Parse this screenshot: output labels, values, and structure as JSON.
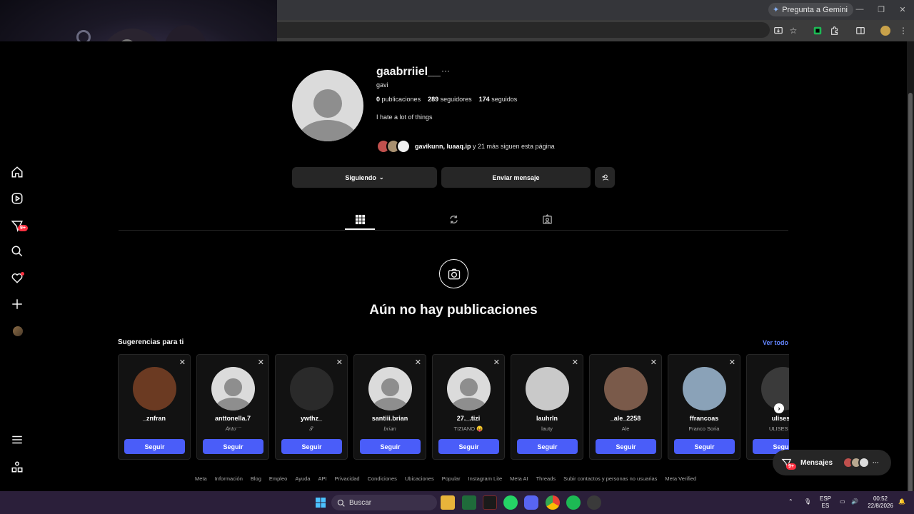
{
  "browser": {
    "gemini_label": "Pregunta a Gemini",
    "gemini_icon": "sparkle-icon"
  },
  "profile": {
    "username": "gaabrriiel__",
    "more": "···",
    "full_name": "gavi",
    "posts_count": "0",
    "posts_label": "publicaciones",
    "followers_count": "289",
    "followers_label": "seguidores",
    "following_count": "174",
    "following_label": "seguidos",
    "bio": "I hate a lot of things",
    "followed_by_names": "gavikunn, luaaq.ip",
    "followed_by_rest": " y 21 más siguen esta página",
    "following_button": "Siguiendo",
    "message_button": "Enviar mensaje"
  },
  "empty_state": {
    "title": "Aún no hay publicaciones"
  },
  "suggestions": {
    "title": "Sugerencias para ti",
    "see_all": "Ver todo",
    "follow_label": "Seguir",
    "close_label": "✕",
    "items": [
      {
        "username": "_znfran",
        "subtitle": "",
        "avatar_color": "#6b3a22"
      },
      {
        "username": "anttonella.7",
        "subtitle": "𝐴𝑛𝑡𝑜 ̈ ͘ ̈",
        "avatar_color": "default"
      },
      {
        "username": "ywthz_",
        "subtitle": "𝒯",
        "avatar_color": "#2a2a2a"
      },
      {
        "username": "santiii.brian",
        "subtitle": "𝑏𝑟𝑖𝑎𝑛",
        "avatar_color": "default"
      },
      {
        "username": "27._.tizi",
        "subtitle": "TIZIANO 😝",
        "avatar_color": "default"
      },
      {
        "username": "lauhrln",
        "subtitle": "lauty",
        "avatar_color": "#c9c9c9"
      },
      {
        "username": "_ale_2258",
        "subtitle": "Ale",
        "avatar_color": "#7a5a4a"
      },
      {
        "username": "ffrancoas",
        "subtitle": "Franco Soria",
        "avatar_color": "#8aa2b8"
      },
      {
        "username": "ulisesc",
        "subtitle": "ULISES 🤍",
        "avatar_color": "#3a3a3a"
      }
    ]
  },
  "footer": [
    "Meta",
    "Información",
    "Blog",
    "Empleo",
    "Ayuda",
    "API",
    "Privacidad",
    "Condiciones",
    "Ubicaciones",
    "Popular",
    "Instagram Lite",
    "Meta AI",
    "Threads",
    "Subir contactos y personas no usuarias",
    "Meta Verified"
  ],
  "messages": {
    "label": "Mensajes",
    "badge": "9+"
  },
  "sidebar": {
    "notif_badge": "9+"
  },
  "taskbar": {
    "search_placeholder": "Buscar",
    "lang_top": "ESP",
    "lang_bottom": "ES",
    "time": "00:52",
    "date": "22/8/2026"
  }
}
